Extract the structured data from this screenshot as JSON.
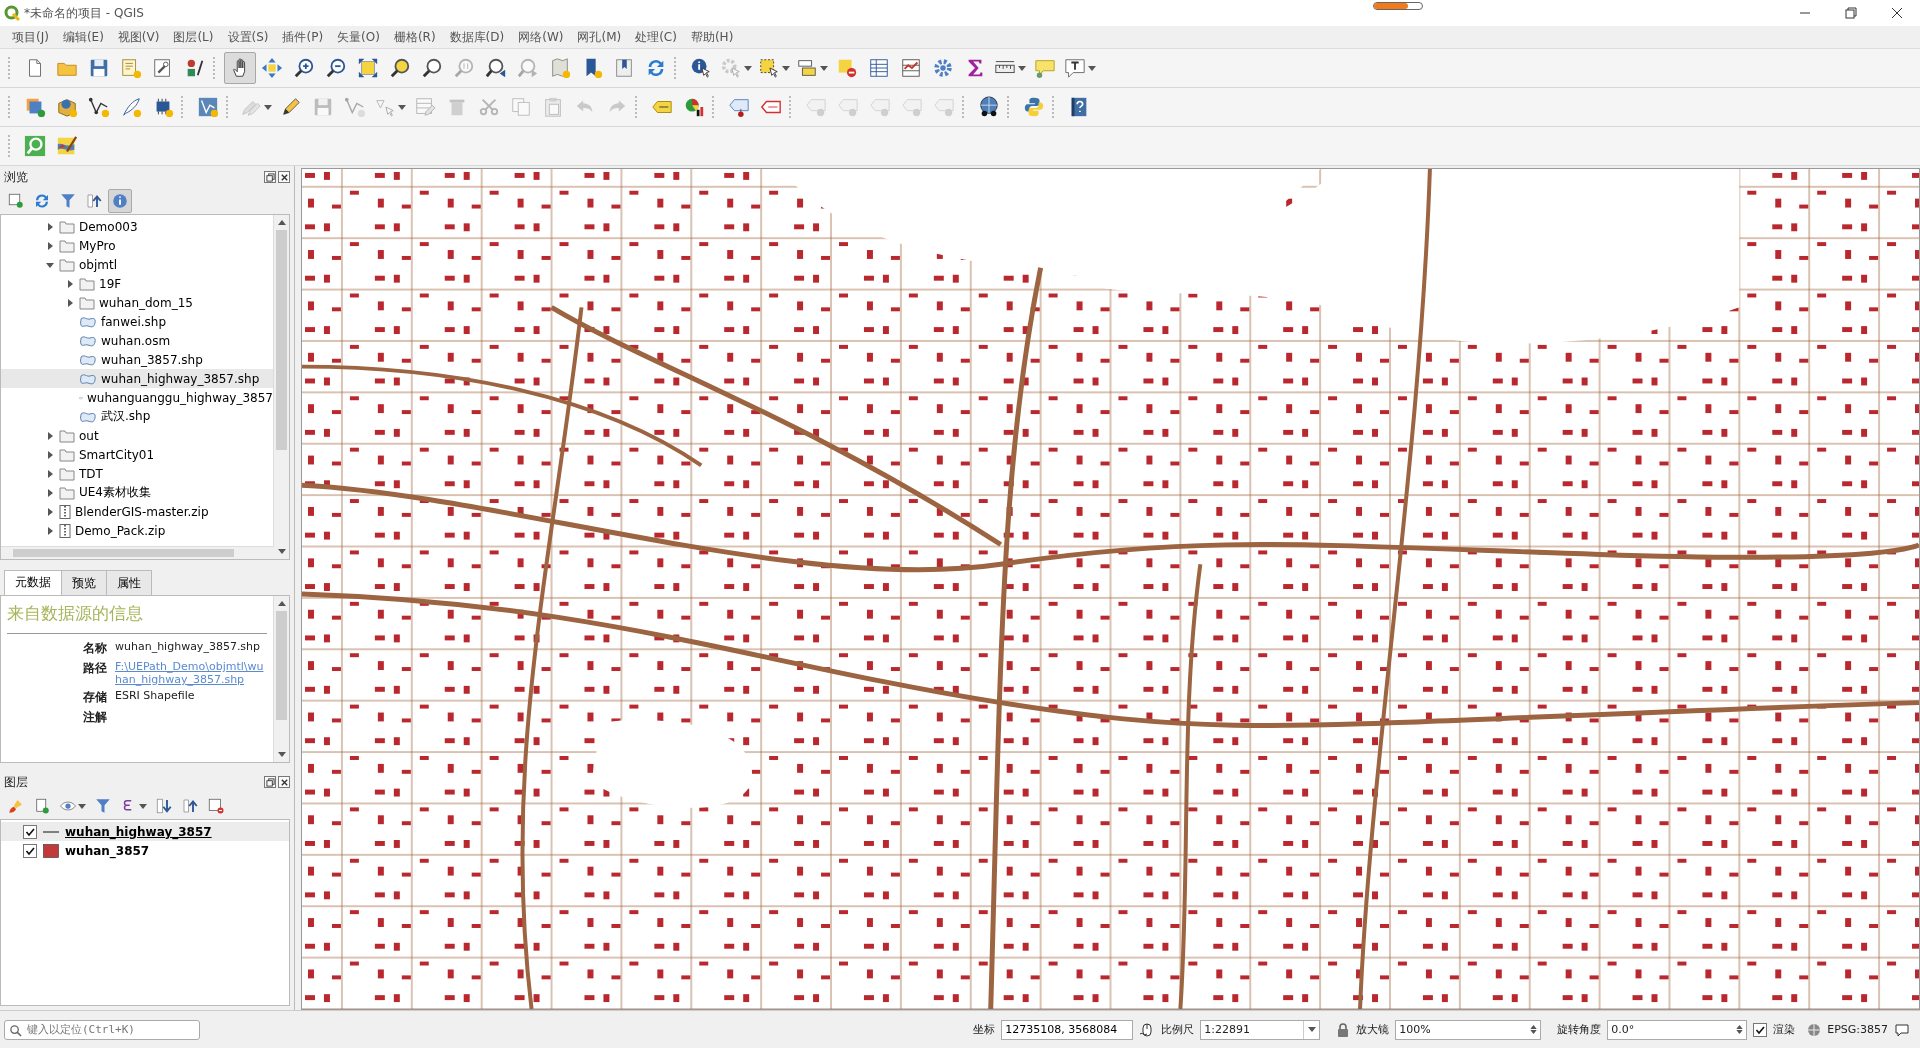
{
  "window": {
    "title": "*未命名的项目 - QGIS"
  },
  "menu": [
    "项目(J)",
    "编辑(E)",
    "视图(V)",
    "图层(L)",
    "设置(S)",
    "插件(P)",
    "矢量(O)",
    "栅格(R)",
    "数据库(D)",
    "网络(W)",
    "网孔(M)",
    "处理(C)",
    "帮助(H)"
  ],
  "toolbars": [
    {
      "buttons": [
        {
          "disabled": false,
          "selected": false
        },
        {
          "disabled": false,
          "selected": false
        },
        {
          "disabled": false,
          "selected": false
        },
        {
          "disabled": false,
          "selected": false
        },
        {
          "disabled": false,
          "selected": false
        },
        {
          "disabled": false,
          "selected": false
        },
        {
          "disabled": false,
          "selected": true
        },
        {
          "disabled": false,
          "selected": false
        },
        {
          "disabled": false,
          "selected": false
        },
        {
          "disabled": false,
          "selected": false
        },
        {
          "disabled": false,
          "selected": false
        },
        {
          "disabled": false,
          "selected": false
        },
        {
          "disabled": false,
          "selected": false
        },
        {
          "disabled": true,
          "selected": false
        },
        {
          "disabled": false,
          "selected": false
        },
        {
          "disabled": true,
          "selected": false
        },
        {
          "disabled": false,
          "selected": false
        },
        {
          "disabled": false,
          "selected": false
        },
        {
          "disabled": false,
          "selected": false
        },
        {
          "disabled": false,
          "selected": false
        },
        {
          "disabled": false,
          "selected": false
        },
        {
          "disabled": true,
          "selected": false
        },
        {
          "disabled": false,
          "selected": false
        },
        {
          "disabled": false,
          "selected": false
        },
        {
          "disabled": false,
          "selected": false
        },
        {
          "disabled": false,
          "selected": false
        },
        {
          "disabled": false,
          "selected": false
        },
        {
          "disabled": false,
          "selected": false
        },
        {
          "disabled": false,
          "selected": false
        },
        {
          "disabled": false,
          "selected": false
        },
        {
          "disabled": false,
          "selected": false
        },
        {
          "disabled": false,
          "selected": false
        }
      ]
    },
    {
      "buttons": [
        {
          "disabled": false,
          "selected": false
        },
        {
          "disabled": false,
          "selected": false
        },
        {
          "disabled": false,
          "selected": false
        },
        {
          "disabled": false,
          "selected": false
        },
        {
          "disabled": false,
          "selected": false
        },
        {
          "disabled": false,
          "selected": false
        },
        {
          "disabled": true,
          "selected": false
        },
        {
          "disabled": false,
          "selected": false
        },
        {
          "disabled": true,
          "selected": false
        },
        {
          "disabled": true,
          "selected": false
        },
        {
          "disabled": true,
          "selected": false
        },
        {
          "disabled": true,
          "selected": false
        },
        {
          "disabled": true,
          "selected": false
        },
        {
          "disabled": true,
          "selected": false
        },
        {
          "disabled": true,
          "selected": false
        },
        {
          "disabled": true,
          "selected": false
        },
        {
          "disabled": true,
          "selected": false
        },
        {
          "disabled": true,
          "selected": false
        },
        {
          "disabled": false,
          "selected": false
        },
        {
          "disabled": false,
          "selected": false
        },
        {
          "disabled": false,
          "selected": false
        },
        {
          "disabled": false,
          "selected": false
        },
        {
          "disabled": true,
          "selected": false
        },
        {
          "disabled": true,
          "selected": false
        },
        {
          "disabled": true,
          "selected": false
        },
        {
          "disabled": true,
          "selected": false
        },
        {
          "disabled": true,
          "selected": false
        },
        {
          "disabled": false,
          "selected": false
        },
        {
          "disabled": false,
          "selected": false
        },
        {
          "disabled": false,
          "selected": false
        }
      ]
    },
    {
      "buttons": [
        {
          "disabled": false,
          "selected": false
        },
        {
          "disabled": false,
          "selected": false
        }
      ]
    }
  ],
  "browser": {
    "title": "浏览",
    "tools": [
      {
        "selected": false
      },
      {
        "selected": false
      },
      {
        "selected": false
      },
      {
        "selected": false
      },
      {
        "selected": true
      }
    ],
    "tree": [
      {
        "label": "Demo003",
        "kind": "folder",
        "expanded": false,
        "selected": false
      },
      {
        "label": "MyPro",
        "kind": "folder",
        "expanded": false,
        "selected": false
      },
      {
        "label": "objmtl",
        "kind": "folder",
        "expanded": true,
        "selected": false,
        "children": [
          {
            "label": "19F",
            "kind": "folder",
            "expanded": false,
            "selected": false
          },
          {
            "label": "wuhan_dom_15",
            "kind": "folder",
            "expanded": false,
            "selected": false
          },
          {
            "label": "fanwei.shp",
            "kind": "vector",
            "selected": false
          },
          {
            "label": "wuhan.osm",
            "kind": "vector",
            "selected": false
          },
          {
            "label": "wuhan_3857.shp",
            "kind": "vector",
            "selected": false
          },
          {
            "label": "wuhan_highway_3857.shp",
            "kind": "vector",
            "selected": true
          },
          {
            "label": "wuhanguanggu_highway_3857",
            "kind": "vector",
            "selected": false
          },
          {
            "label": "武汉.shp",
            "kind": "vector",
            "selected": false
          }
        ]
      },
      {
        "label": "out",
        "kind": "folder",
        "expanded": false,
        "selected": false
      },
      {
        "label": "SmartCity01",
        "kind": "folder",
        "expanded": false,
        "selected": false
      },
      {
        "label": "TDT",
        "kind": "folder",
        "expanded": false,
        "selected": false
      },
      {
        "label": "UE4素材收集",
        "kind": "folder",
        "expanded": false,
        "selected": false
      },
      {
        "label": "BlenderGIS-master.zip",
        "kind": "zip",
        "expanded": false,
        "selected": false
      },
      {
        "label": "Demo_Pack.zip",
        "kind": "zip",
        "expanded": false,
        "selected": false
      }
    ]
  },
  "metadata": {
    "tabs": [
      {
        "label": "元数据",
        "selected": true
      },
      {
        "label": "预览",
        "selected": false
      },
      {
        "label": "属性",
        "selected": false
      }
    ],
    "heading": "来自数据源的信息",
    "fields": [
      {
        "label": "名称",
        "value": "wuhan_highway_3857.shp",
        "kind": "text"
      },
      {
        "label": "路径",
        "value": "F:\\UEPath_Demo\\objmtl\\wuhan_highway_3857.shp",
        "kind": "link"
      },
      {
        "label": "存储",
        "value": "ESRI Shapefile",
        "kind": "text"
      },
      {
        "label": "注解",
        "kind": "text"
      }
    ]
  },
  "layers": {
    "title": "图层",
    "items": [
      {
        "name": "wuhan_highway_3857",
        "kind": "line",
        "color": "#7f7f7f",
        "checked": true,
        "selected": true
      },
      {
        "name": "wuhan_3857",
        "kind": "fill",
        "color": "#c23b3b",
        "checked": true,
        "selected": false
      }
    ]
  },
  "locator": {
    "placeholder": "键入以定位(Ctrl+K)"
  },
  "status": {
    "coordinate_label": "坐标",
    "coordinate": "12735108, 3568084",
    "scale_label": "比例尺",
    "scale": "1:22891",
    "magnifier_label": "放大镜",
    "magnifier": "100%",
    "rotation_label": "旋转角度",
    "rotation": "0.0°",
    "render_label": "渲染",
    "render": true,
    "crs": "EPSG:3857"
  }
}
